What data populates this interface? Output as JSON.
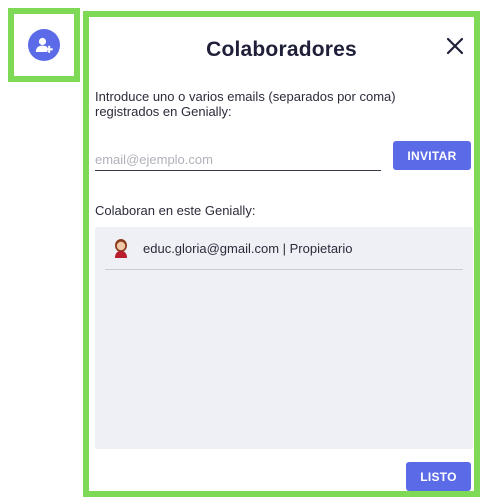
{
  "modal": {
    "title": "Colaboradores",
    "intro": "Introduce uno o varios emails (separados por coma) registrados en Genially:",
    "email_placeholder": "email@ejemplo.com",
    "invite_label": "INVITAR",
    "collaborators_label": "Colaboran en este Genially:",
    "collaborators": [
      {
        "text": "educ.gloria@gmail.com | Propietario",
        "avatar": "user-avatar-icon"
      }
    ],
    "done_label": "LISTO"
  },
  "sidebar": {
    "button_icon": "add-user-icon"
  },
  "colors": {
    "accent": "#5b6be8",
    "highlight": "#7ed957",
    "list_bg": "#eef0f5"
  }
}
